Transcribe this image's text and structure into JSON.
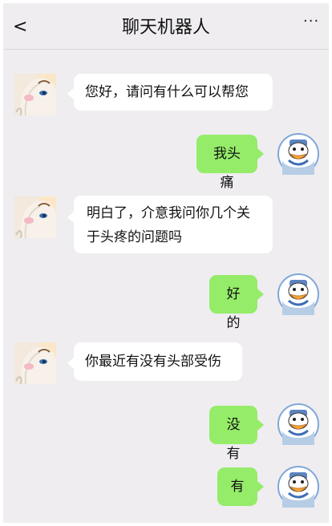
{
  "header": {
    "back_label": "<",
    "title": "聊天机器人",
    "more_label": "···"
  },
  "messages": [
    {
      "sender": "bot",
      "text": "您好，请问有什么可以帮您"
    },
    {
      "sender": "user",
      "text": "我头痛"
    },
    {
      "sender": "bot",
      "text": "明白了，介意我问你几个关于头疼的问题吗"
    },
    {
      "sender": "user",
      "text": "好的"
    },
    {
      "sender": "bot",
      "text": "你最近有没有头部受伤"
    },
    {
      "sender": "user",
      "text": "没有"
    },
    {
      "sender": "user",
      "text": "有"
    }
  ],
  "colors": {
    "background": "#efedf0",
    "user_bubble": "#95ec69",
    "bot_bubble": "#ffffff"
  }
}
